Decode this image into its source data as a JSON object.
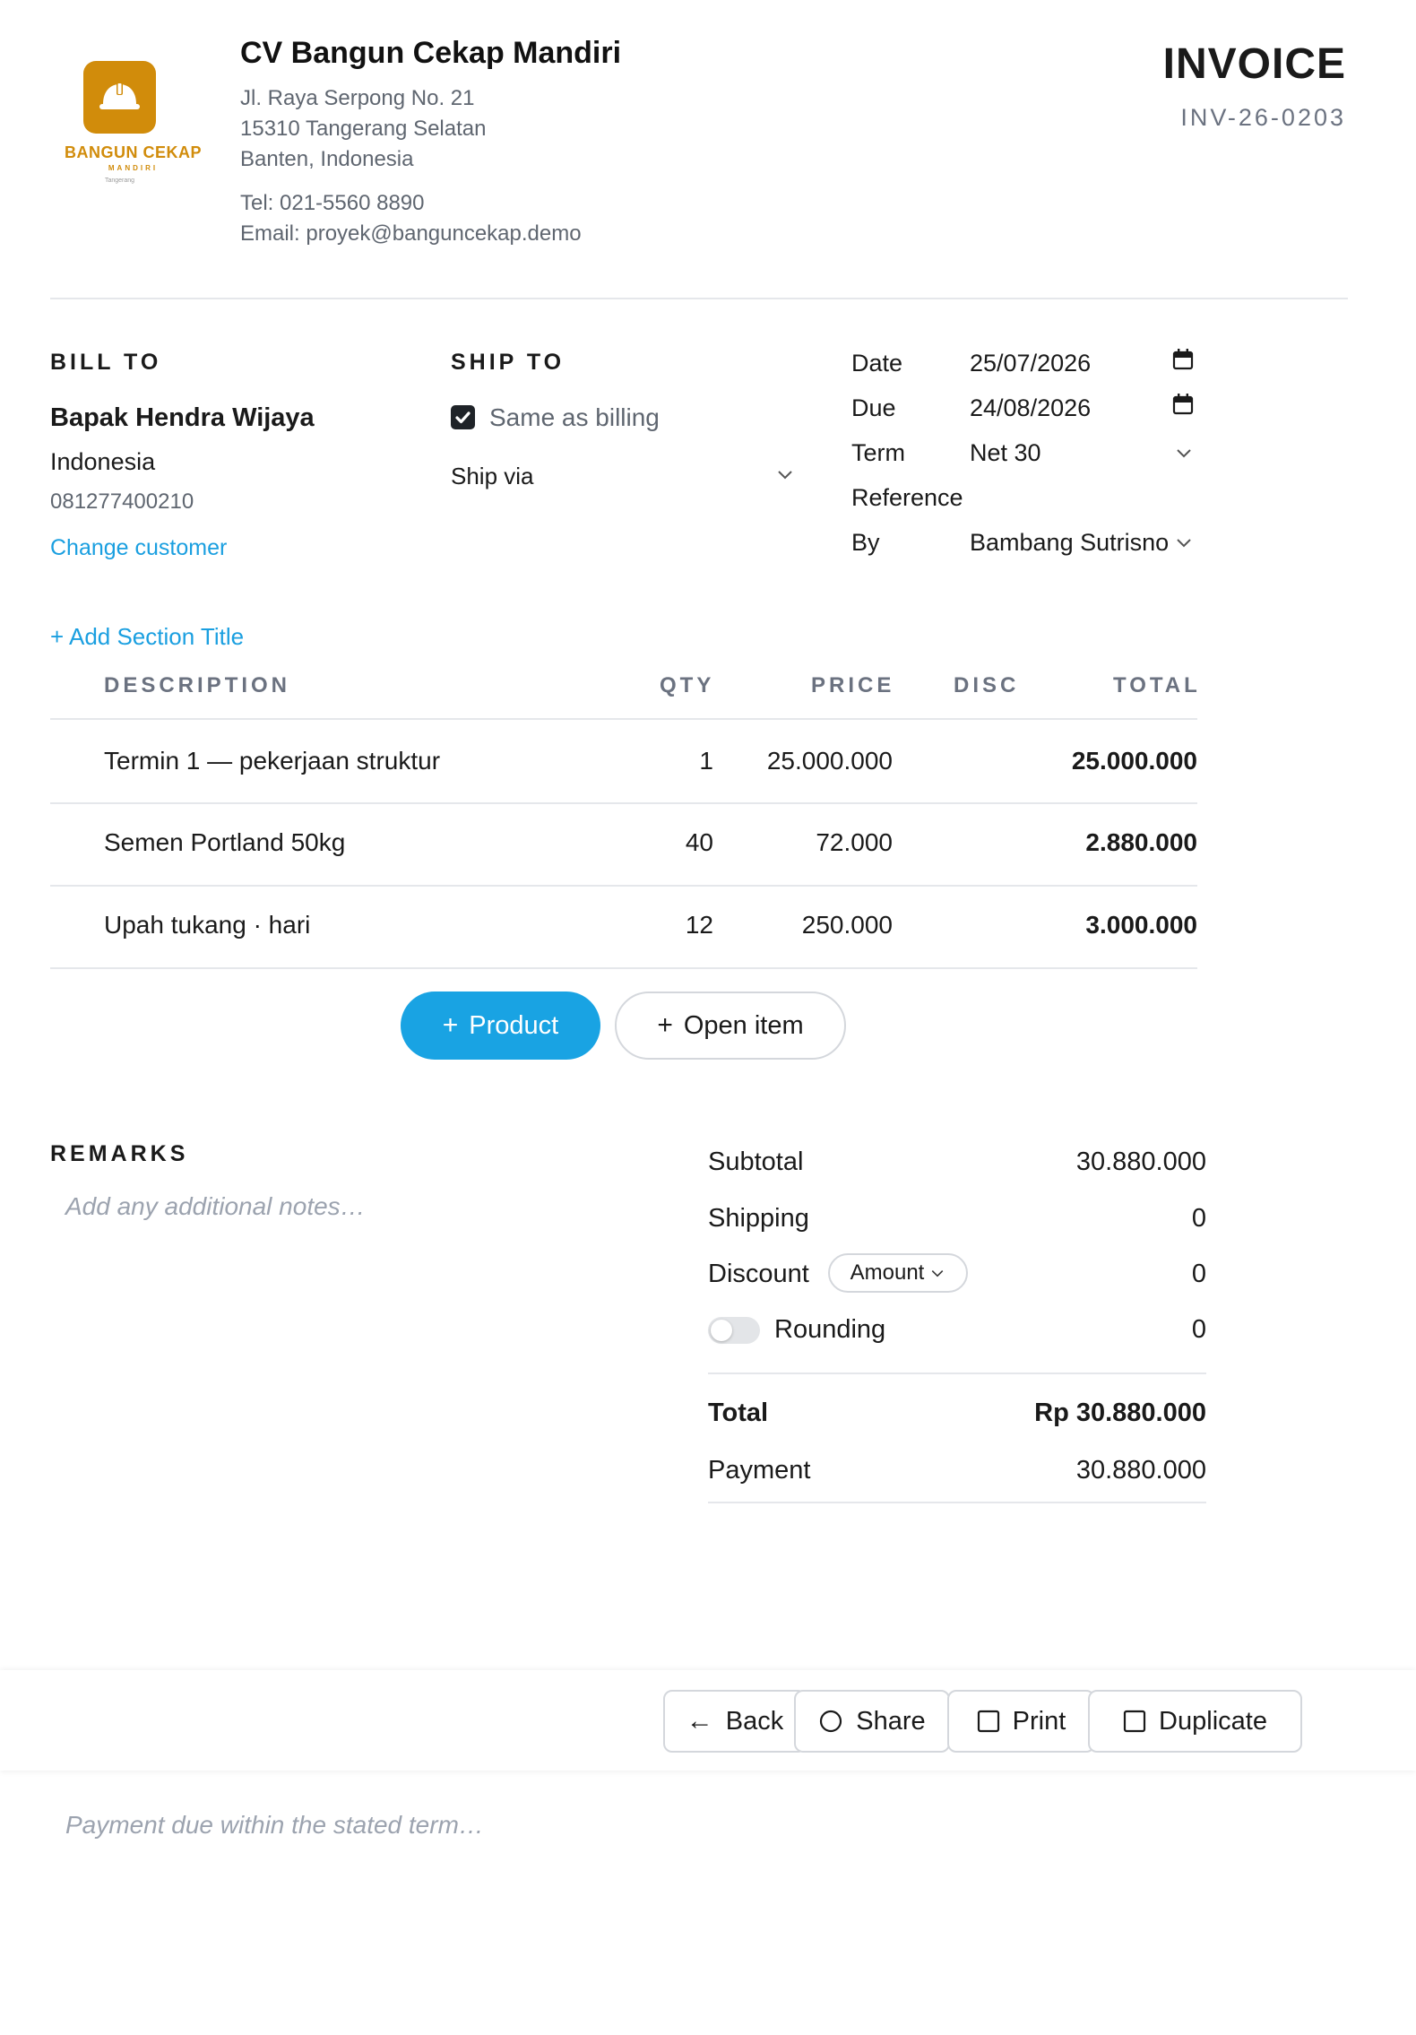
{
  "company": {
    "logo_name": "BANGUN CEKAP",
    "logo_sub": "MANDIRI",
    "logo_location": "Tangerang",
    "name": "CV Bangun Cekap Mandiri",
    "address_line1": "Jl. Raya Serpong No. 21",
    "address_line2": "15310 Tangerang Selatan",
    "address_line3": "Banten, Indonesia",
    "tel": "Tel: 021-5560 8890",
    "email": "Email: proyek@banguncekap.demo"
  },
  "invoice": {
    "title": "INVOICE",
    "number": "INV-26-0203"
  },
  "bill_to": {
    "heading": "BILL TO",
    "name": "Bapak Hendra Wijaya",
    "country": "Indonesia",
    "phone": "081277400210",
    "change_link": "Change customer"
  },
  "ship_to": {
    "heading": "SHIP TO",
    "same_as_billing_label": "Same as billing",
    "same_as_billing_checked": true,
    "ship_via_label": "Ship via"
  },
  "meta": {
    "date_label": "Date",
    "date_value": "25/07/2026",
    "due_label": "Due",
    "due_value": "24/08/2026",
    "term_label": "Term",
    "term_value": "Net 30",
    "reference_label": "Reference",
    "reference_value": "",
    "by_label": "By",
    "by_value": "Bambang Sutrisno"
  },
  "add_section": "+ Add Section Title",
  "table": {
    "headers": {
      "description": "DESCRIPTION",
      "qty": "QTY",
      "price": "PRICE",
      "disc": "DISC",
      "total": "TOTAL"
    },
    "rows": [
      {
        "description": "Termin 1 — pekerjaan struktur",
        "qty": "1",
        "price": "25.000.000",
        "disc": "",
        "total": "25.000.000"
      },
      {
        "description": "Semen Portland 50kg",
        "qty": "40",
        "price": "72.000",
        "disc": "",
        "total": "2.880.000"
      },
      {
        "description": "Upah tukang · hari",
        "qty": "12",
        "price": "250.000",
        "disc": "",
        "total": "3.000.000"
      }
    ]
  },
  "add_buttons": {
    "product": "Product",
    "open_item": "Open item"
  },
  "remarks": {
    "heading": "REMARKS",
    "placeholder": "Add any additional notes…"
  },
  "summary": {
    "subtotal_label": "Subtotal",
    "subtotal_value": "30.880.000",
    "shipping_label": "Shipping",
    "shipping_value": "0",
    "discount_label": "Discount",
    "discount_mode": "Amount",
    "discount_value": "0",
    "rounding_label": "Rounding",
    "rounding_enabled": false,
    "rounding_value": "0",
    "total_label": "Total",
    "total_value": "Rp 30.880.000",
    "payment_label": "Payment",
    "payment_value": "30.880.000"
  },
  "actions": {
    "back": "Back",
    "share": "Share",
    "print": "Print",
    "duplicate": "Duplicate"
  },
  "footer_notes": {
    "placeholder": "Payment due within the stated term…"
  },
  "colors": {
    "accent": "#19a3e3",
    "brand": "#d18c0b",
    "text": "#1a1a1a",
    "muted": "#5f6670"
  }
}
